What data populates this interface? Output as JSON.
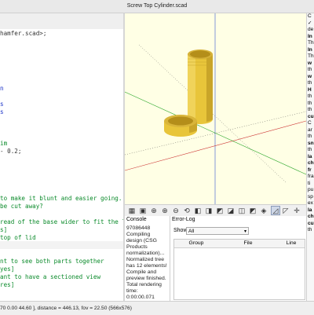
{
  "window": {
    "title": "Screw Top Cylinder.scad"
  },
  "editor": {
    "lines": [
      {
        "text": "hamfer.scad>;",
        "style": "dark"
      },
      {
        "text": "",
        "style": "dark"
      },
      {
        "text": "",
        "style": "dark"
      },
      {
        "text": "",
        "style": "dark"
      },
      {
        "text": "",
        "style": "dark"
      },
      {
        "text": "",
        "style": "dark"
      },
      {
        "text": "",
        "style": "dark"
      },
      {
        "text": "",
        "style": "dark"
      },
      {
        "text": "",
        "style": "dark"
      },
      {
        "text": "",
        "style": "dark"
      },
      {
        "text": "",
        "style": "dark"
      },
      {
        "text": "",
        "style": "dark"
      },
      {
        "text": "",
        "style": "dark"
      },
      {
        "text": "",
        "style": "dark"
      },
      {
        "text": "im",
        "style": "green"
      },
      {
        "text": "- 0.2;",
        "style": "dark"
      },
      {
        "text": "",
        "style": "dark"
      },
      {
        "text": "",
        "style": "dark"
      },
      {
        "text": "",
        "style": "dark"
      },
      {
        "text": "",
        "style": "dark"
      },
      {
        "text": "",
        "style": "dark"
      },
      {
        "text": "to make it blunt and easier going.",
        "style": "green"
      },
      {
        "text": "be cut away?",
        "style": "green"
      },
      {
        "text": "",
        "style": "dark"
      },
      {
        "text": "read of the base wider to fit the lid",
        "style": "green"
      },
      {
        "text": "s]",
        "style": "green"
      },
      {
        "text": "top of lid",
        "style": "green"
      },
      {
        "text": "",
        "style": "dark"
      },
      {
        "text": "",
        "style": "dark"
      },
      {
        "text": "nt to see both parts together",
        "style": "green"
      },
      {
        "text": "yes]",
        "style": "green"
      },
      {
        "text": "ant to have a sectioned view",
        "style": "green"
      },
      {
        "text": "res]",
        "style": "green"
      }
    ],
    "fragments": [
      {
        "text": "n",
        "style": "blue",
        "row": 7
      },
      {
        "text": "s",
        "style": "blue",
        "row": 9
      },
      {
        "text": "s",
        "style": "blue",
        "row": 10
      }
    ]
  },
  "console": {
    "title": "Console",
    "lines": [
      "97086448",
      "Compiling",
      "design (CSG",
      "Products",
      "normalization)...",
      "Normalized tree",
      "has 12 elements!",
      "Compile and",
      "preview finished.",
      "Total rendering",
      "time:",
      "0:00:00.071"
    ]
  },
  "error_log": {
    "title": "Error-Log",
    "show_label": "Show",
    "show_value": "All",
    "columns": [
      "Group",
      "File",
      "Line"
    ]
  },
  "statusbar": {
    "text": "70 0.00 44.60 ], distance = 446.13, fov = 22.50 (566x576)"
  },
  "rightpane": {
    "lines": [
      "C",
      "✓",
      "de",
      "",
      "In",
      "Th",
      "In",
      "Th",
      "w",
      "th",
      "w",
      "th",
      "H",
      "th",
      "th",
      "th",
      "cu",
      "C",
      "ar",
      "th",
      "sn",
      "th",
      "la",
      "ch",
      "",
      "fr",
      "fra",
      "ti",
      "pu",
      "sp",
      "ex",
      "la",
      "ch",
      "cu",
      "th"
    ]
  },
  "toolbar": {
    "icons": [
      "preview-icon",
      "render-icon",
      "zoom-all-icon",
      "zoom-in-icon",
      "zoom-out-icon",
      "reset-view-icon",
      "view-right-icon",
      "view-top-icon",
      "view-bottom-icon",
      "view-left-icon",
      "view-front-icon",
      "view-back-icon",
      "view-diagonal-icon",
      "perspective-icon",
      "orthogonal-icon",
      "show-axes-icon"
    ]
  },
  "colors": {
    "model_yellow": "#e8c53a",
    "model_yellow_dark": "#b48e1a",
    "viewport_bg": "#ffffe5",
    "axis_red": "#cc3333",
    "axis_green": "#33aa33",
    "axis_blue": "#3355cc"
  }
}
